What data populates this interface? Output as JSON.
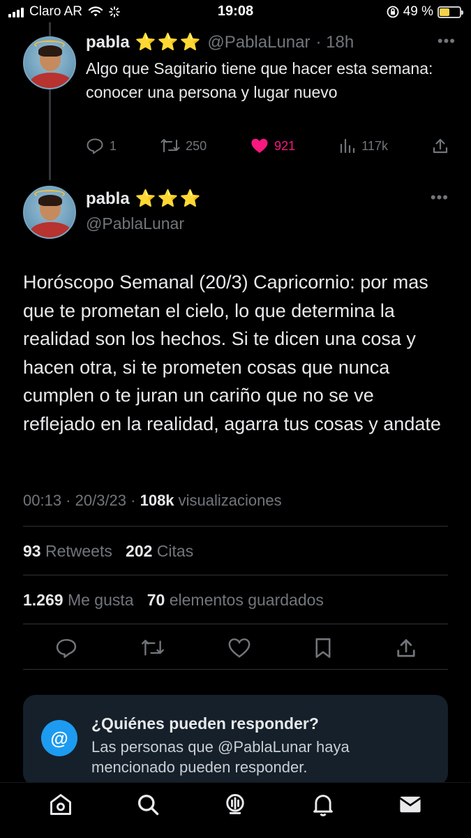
{
  "status_bar": {
    "carrier": "Claro AR",
    "time": "19:08",
    "battery_percent": "49 %",
    "battery_level": 0.49,
    "icons": [
      "signal-icon",
      "wifi-icon",
      "activity-icon",
      "orientation-lock-icon",
      "battery-icon"
    ]
  },
  "reply_tweet": {
    "name": "pabla",
    "badge": "⭐⭐⭐",
    "handle": "@PablaLunar",
    "age": "· 18h",
    "text": "Algo que Sagitario tiene que hacer esta semana: conocer una persona y lugar nuevo",
    "replies": "1",
    "retweets": "250",
    "likes": "921",
    "views": "117k"
  },
  "main_tweet": {
    "name": "pabla",
    "badge": "⭐⭐⭐",
    "handle": "@PablaLunar",
    "text": "Horóscopo Semanal (20/3) Capricornio: por mas que te prometan el cielo, lo que determina la realidad son los hechos. Si te dicen una cosa y hacen otra, si te prometen cosas que nunca cumplen o te juran un cariño que no se ve reflejado en la realidad, agarra tus cosas y andate",
    "time": "00:13",
    "date": "20/3/23",
    "views_count": "108k",
    "views_label": "visualizaciones",
    "retweets_count": "93",
    "retweets_label": "Retweets",
    "quotes_count": "202",
    "quotes_label": "Citas",
    "likes_count": "1.269",
    "likes_label": "Me gusta",
    "bookmarks_count": "70",
    "bookmarks_label": "elementos guardados"
  },
  "reply_card": {
    "icon": "@",
    "title": "¿Quiénes pueden responder?",
    "body": "Las personas que @PablaLunar haya mencionado pueden responder."
  },
  "colors": {
    "background": "#000000",
    "like": "#f91880",
    "accent": "#1d9bf0",
    "muted": "#71767b",
    "card": "#15202b"
  },
  "tabbar": [
    "home-icon",
    "search-icon",
    "spaces-icon",
    "notifications-icon",
    "messages-icon"
  ]
}
